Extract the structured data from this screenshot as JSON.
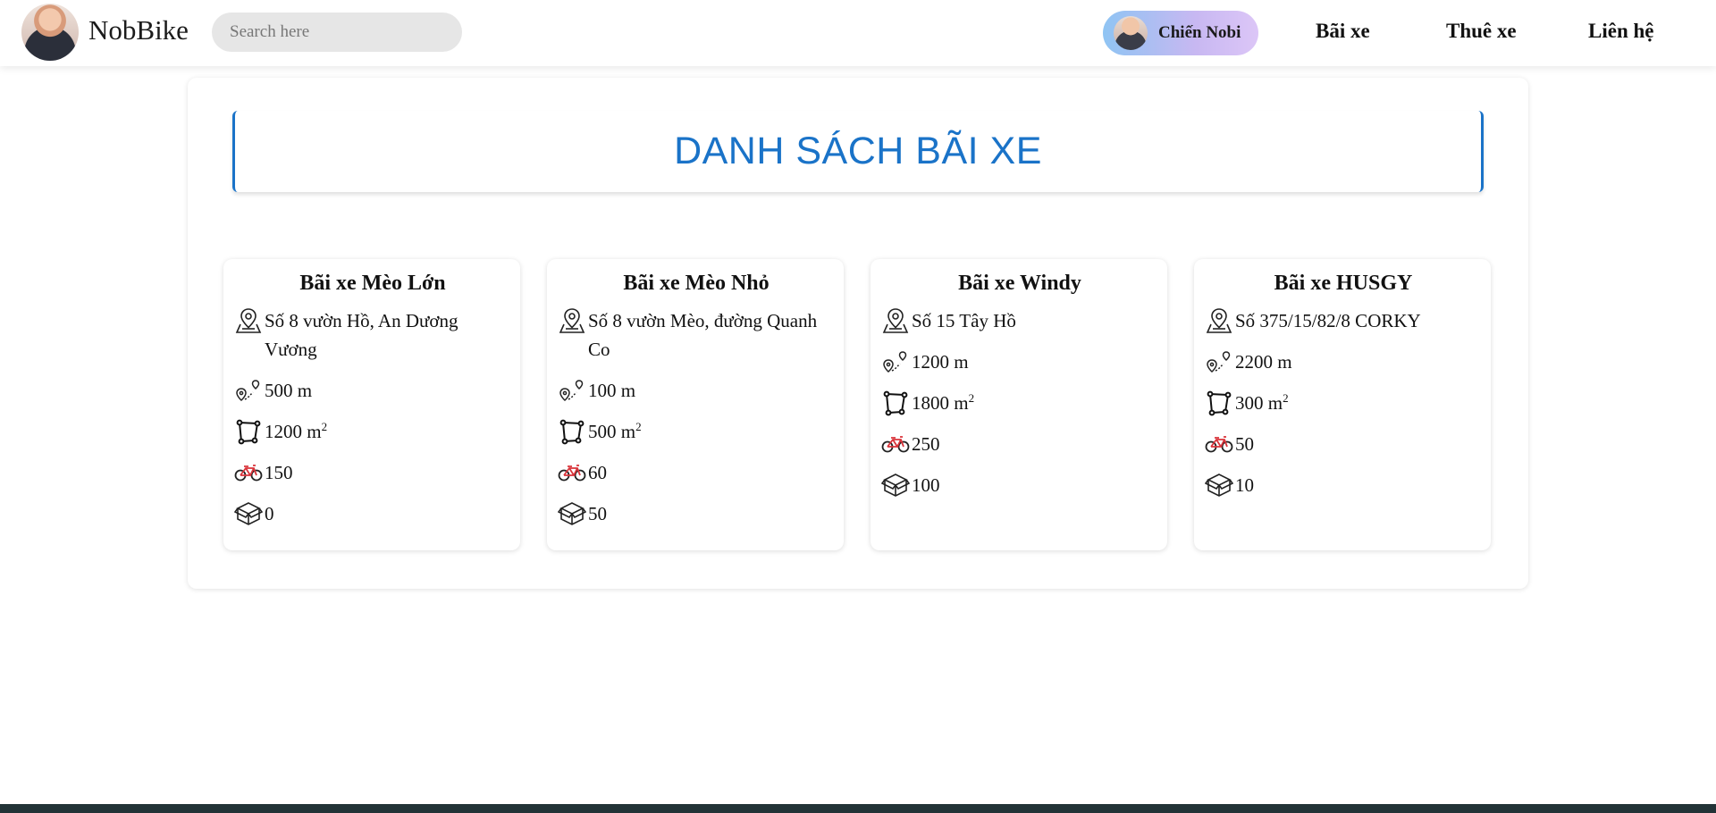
{
  "header": {
    "brand": "NobBike",
    "search_placeholder": "Search here",
    "user_name": "Chiến Nobi",
    "nav": [
      "Bãi xe",
      "Thuê xe",
      "Liên hệ"
    ]
  },
  "page_title": "DANH SÁCH BÃI XE",
  "colors": {
    "accent": "#1a73c8",
    "bike_icon": "#d9343b"
  },
  "icons": {
    "address": "map-pin-icon",
    "distance": "route-icon",
    "area": "polygon-area-icon",
    "bikes": "bicycle-icon",
    "boxes": "box-icon"
  },
  "lots": [
    {
      "name": "Bãi xe Mèo Lớn",
      "address": "Số 8 vườn Hồ, An Dương Vương",
      "distance": "500 m",
      "area": "1200 m",
      "area_sup": "2",
      "bikes": "150",
      "boxes": "0"
    },
    {
      "name": "Bãi xe Mèo Nhỏ",
      "address": "Số 8 vườn Mèo, đường Quanh Co",
      "distance": "100 m",
      "area": "500 m",
      "area_sup": "2",
      "bikes": "60",
      "boxes": "50"
    },
    {
      "name": "Bãi xe Windy",
      "address": "Số 15 Tây Hồ",
      "distance": "1200 m",
      "area": "1800 m",
      "area_sup": "2",
      "bikes": "250",
      "boxes": "100"
    },
    {
      "name": "Bãi xe HUSGY",
      "address": "Số 375/15/82/8 CORKY",
      "distance": "2200 m",
      "area": "300 m",
      "area_sup": "2",
      "bikes": "50",
      "boxes": "10"
    }
  ]
}
